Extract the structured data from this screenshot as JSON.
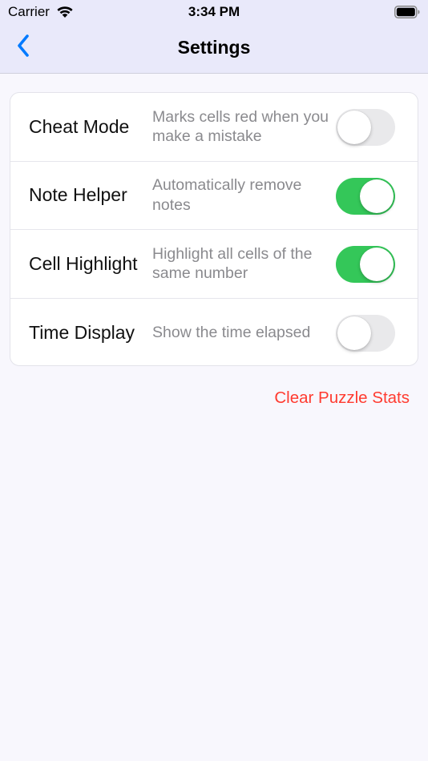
{
  "status_bar": {
    "carrier": "Carrier",
    "time": "3:34 PM",
    "wifi_icon": "wifi-icon",
    "battery_icon": "battery-icon"
  },
  "nav": {
    "title": "Settings",
    "back_icon": "chevron-left-icon"
  },
  "settings": [
    {
      "title": "Cheat Mode",
      "description": "Marks cells red when you make a mistake",
      "enabled": false
    },
    {
      "title": "Note Helper",
      "description": "Automatically remove notes",
      "enabled": true
    },
    {
      "title": "Cell Highlight",
      "description": "Highlight all cells of the same number",
      "enabled": true
    },
    {
      "title": "Time Display",
      "description": "Show the time elapsed",
      "enabled": false
    }
  ],
  "actions": {
    "clear_label": "Clear Puzzle Stats"
  },
  "colors": {
    "accent": "#007aff",
    "toggle_on": "#34c759",
    "toggle_off": "#e9e9eb",
    "destructive": "#ff3b30",
    "nav_background": "#e9e9fa"
  }
}
